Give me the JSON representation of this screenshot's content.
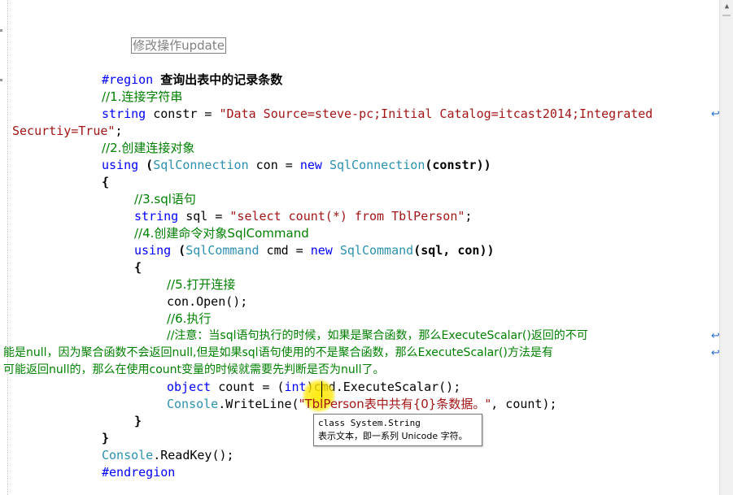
{
  "editor": {
    "collapsed_region": "修改操作update",
    "lines": {
      "region_kw": "#region",
      "region_title": "查询出表中的记录条数",
      "c1": "//1.连接字符串",
      "constr_type": "string",
      "constr_mid": " constr = ",
      "constr_str": "\"Data Source=steve-pc;Initial Catalog=itcast2014;Integrated",
      "constr_wrap": "Securtiy=True\"",
      "constr_end": ";",
      "c2": "//2.创建连接对象",
      "using_kw": "using",
      "open_paren": " (",
      "sqlconn_type": "SqlConnection",
      "con_mid": " con = ",
      "new_kw": "new",
      "sqlconn_type2": " SqlConnection",
      "con_end": "(constr))",
      "brace_open": "{",
      "c3": "//3.sql语句",
      "sql_type": "string",
      "sql_mid": " sql = ",
      "sql_str": "\"select count(*) from TblPerson\"",
      "sql_end": ";",
      "c4": "//4.创建命令对象SqlCommand",
      "using_kw2": "using",
      "open_paren2": " (",
      "sqlcmd_type": "SqlCommand",
      "cmd_mid": " cmd = ",
      "new_kw2": "new",
      "sqlcmd_type2": " SqlCommand",
      "cmd_end": "(sql, con))",
      "brace_open2": "{",
      "c5": "//5.打开连接",
      "con_open": "con.Open();",
      "c6": "//6.执行",
      "note1": "//注意：当sql语句执行的时候，如果是聚合函数，那么ExecuteScalar()返回的不可",
      "note2": "能是null，因为聚合函数不会返回null,但是如果sql语句使用的不是聚合函数，那么ExecuteScalar()方法是有",
      "note3": "可能返回null的，那么在使用count变量的时候就需要先判断是否为null了。",
      "obj_kw": "object",
      "obj_mid": " count = (",
      "int_kw": "int",
      "obj_end": ")cmd.ExecuteScalar();",
      "console_type": "Console",
      "writeline_mid": ".WriteLine(",
      "wl_str": "\"TblPerson表中共有{0}条数据。\"",
      "wl_end": ", count);",
      "brace_close2": "}",
      "brace_close": "}",
      "console_type2": "Console",
      "readkey": ".ReadKey();",
      "endregion": "#endregion"
    }
  },
  "tooltip": {
    "line1": "class System.String",
    "line2": "表示文本，即一系列 Unicode 字符。"
  },
  "wrap_glyph": "↩",
  "scrollbar": {
    "up_arrow": "▲"
  },
  "colors": {
    "keyword": "#0000ff",
    "type": "#2b91af",
    "string": "#a31515",
    "comment": "#008000"
  }
}
